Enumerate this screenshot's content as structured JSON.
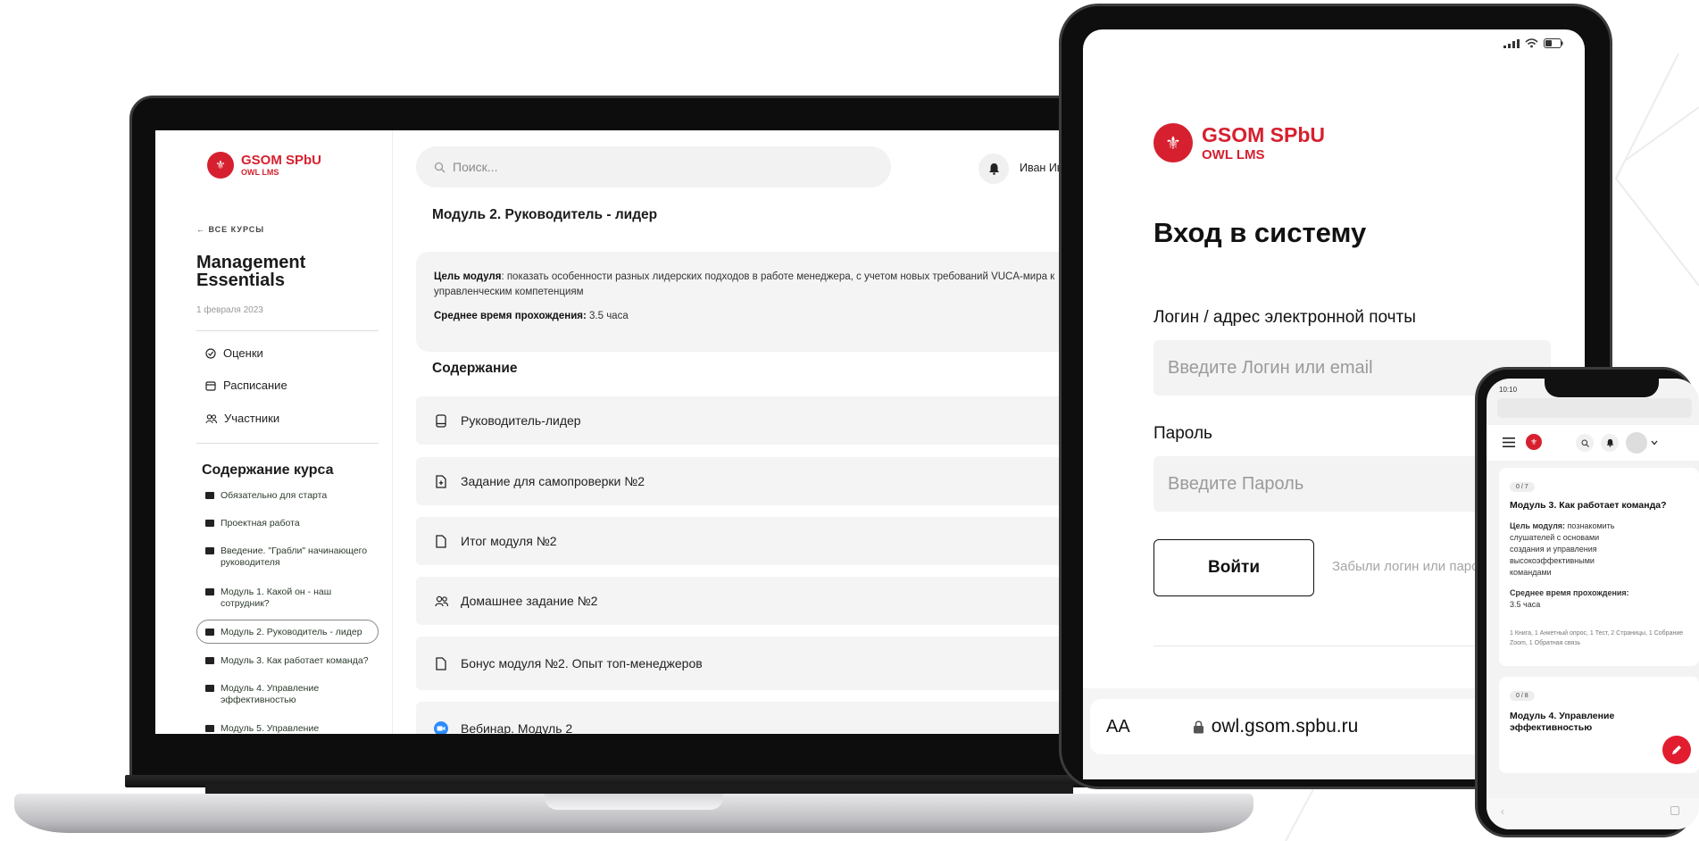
{
  "brand": {
    "name": "GSOM SPbU",
    "product": "OWL LMS"
  },
  "laptop": {
    "sidebar": {
      "back_label": "← ВСЕ КУРСЫ",
      "course_title": "Management Essentials",
      "course_date": "1 февраля 2023",
      "nav": [
        {
          "label": "Оценки",
          "icon": "check-circle-icon"
        },
        {
          "label": "Расписание",
          "icon": "calendar-icon"
        },
        {
          "label": "Участники",
          "icon": "users-icon"
        }
      ],
      "toc_title": "Содержание курса",
      "toc": [
        "Обязательно для старта",
        "Проектная работа",
        "Введение. \"Грабли\" начинающего руководителя",
        "Модуль 1. Какой он - наш сотрудник?",
        "Модуль 2. Руководитель - лидер",
        "Модуль 3. Как работает команда?",
        "Модуль 4. Управление эффективностью",
        "Модуль 5. Управление"
      ]
    },
    "search": {
      "placeholder": "Поиск..."
    },
    "user": {
      "name": "Иван Иванович И."
    },
    "module": {
      "title": "Модуль 2. Руководитель - лидер",
      "goal_label": "Цель модуля",
      "goal_text": ": показать особенности разных лидерских подходов в работе менеджера, с учетом новых требований VUCA-мира к",
      "goal_text_2": "управленческим компетенциям",
      "time_label": "Среднее время прохождения:",
      "time_value": " 3.5 часа"
    },
    "contents_title": "Содержание",
    "contents": [
      {
        "label": "Руководитель-лидер",
        "icon": "book-icon"
      },
      {
        "label": "Задание для самопроверки №2",
        "icon": "file-plus-icon"
      },
      {
        "label": "Итог модуля №2",
        "icon": "file-icon"
      },
      {
        "label": "Домашнее задание №2",
        "icon": "users-icon"
      },
      {
        "label": "Бонус модуля №2. Опыт топ-менеджеров",
        "icon": "file-icon"
      },
      {
        "label": "Вебинар. Модуль 2",
        "icon": "video-icon"
      }
    ]
  },
  "tablet": {
    "title": "Вход в систему",
    "login_label": "Логин / адрес электронной почты",
    "login_placeholder": "Введите Логин или email",
    "password_label": "Пароль",
    "password_placeholder": "Введите Пароль",
    "submit_label": "Войти",
    "forgot_label": "Забыли логин или пароль?",
    "url_text_size": "AA",
    "url": "owl.gsom.spbu.ru"
  },
  "phone": {
    "time": "10:10",
    "card1": {
      "progress": "0 / 7",
      "title": "Модуль 3. Как работает команда?",
      "goal_label": "Цель модуля:",
      "goal_text": " познакомить слушателей с основами создания и управления высокоэффективными командами",
      "time_label": "Среднее время прохождения:",
      "time_value": " 3.5 часа",
      "summary": "1 Книга, 1 Анкетный опрос, 1 Тест, 2 Страницы, 1 Собрание Zoom, 1 Обратная связь"
    },
    "card2": {
      "progress": "0 / 8",
      "title": "Модуль 4. Управление эффективностью"
    }
  },
  "colors": {
    "brand_red": "#d6202f",
    "zoom_blue": "#2d8cff"
  }
}
